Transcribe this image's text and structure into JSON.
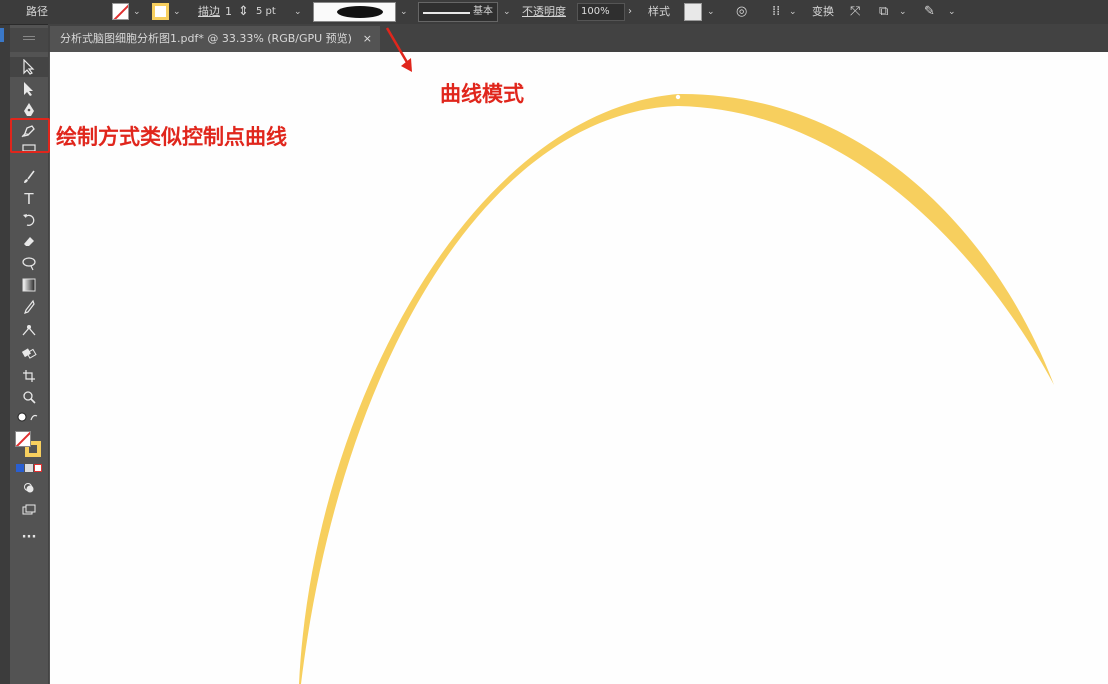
{
  "control_bar": {
    "object_type": "路径",
    "stroke_label": "描边",
    "stroke_weight": "1",
    "variable_width_value": "5 pt",
    "brush_label": "基本",
    "opacity_label": "不透明度",
    "opacity_value": "100%",
    "style_label": "样式",
    "transform_label": "变换"
  },
  "document_tab": {
    "title": "分析式脑图细胞分析图1.pdf* @ 33.33% (RGB/GPU 预览)",
    "close_glyph": "×"
  },
  "annotations": {
    "tool_note": "绘制方式类似控制点曲线",
    "profile_note": "曲线模式"
  },
  "colors": {
    "accent_red": "#e0261c",
    "stroke_yellow": "#f7cf5e",
    "ui_dark": "#535353"
  },
  "tools": [
    {
      "name": "selection-tool",
      "icon": "arrow"
    },
    {
      "name": "direct-selection-tool",
      "icon": "hollow-arrow"
    },
    {
      "name": "pen-tool",
      "icon": "pen"
    },
    {
      "name": "curvature-tool",
      "icon": "curvature-pen"
    },
    {
      "name": "rectangle-tool",
      "icon": "rectangle"
    },
    {
      "name": "paintbrush-tool",
      "icon": "brush"
    },
    {
      "name": "type-tool",
      "icon": "T"
    },
    {
      "name": "rotate-tool",
      "icon": "rotate"
    },
    {
      "name": "eraser-tool",
      "icon": "eraser"
    },
    {
      "name": "lasso-tool",
      "icon": "lasso"
    },
    {
      "name": "gradient-tool",
      "icon": "gradient"
    },
    {
      "name": "eyedropper-tool",
      "icon": "eyedropper"
    },
    {
      "name": "puppet-warp-tool",
      "icon": "puppet"
    },
    {
      "name": "blend-tool",
      "icon": "blend"
    },
    {
      "name": "artboard-tool",
      "icon": "artboard"
    },
    {
      "name": "zoom-tool",
      "icon": "zoom"
    }
  ],
  "more_tools_glyph": "···",
  "type_tool_glyph": "T"
}
